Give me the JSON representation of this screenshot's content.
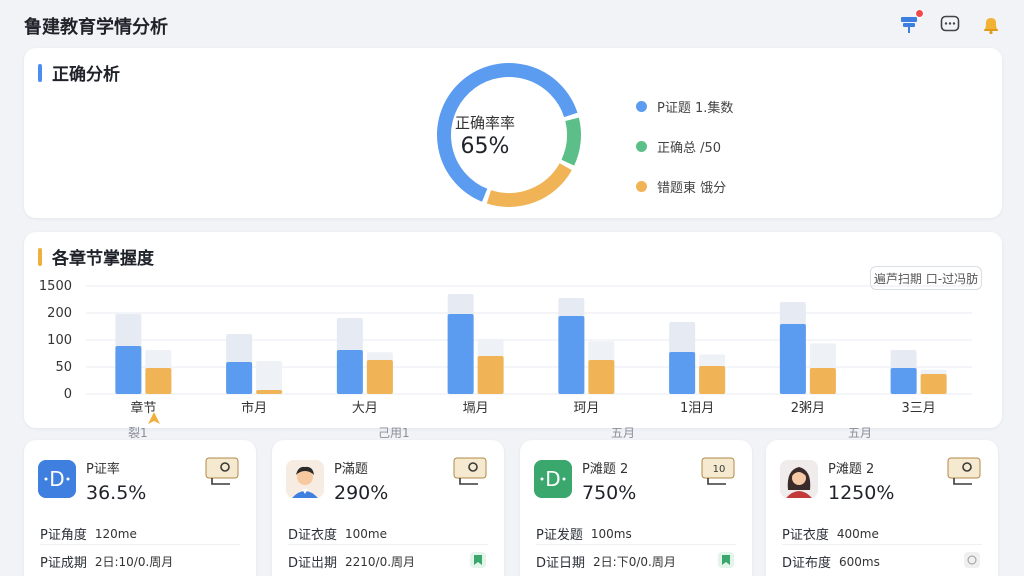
{
  "app_title": "鲁建教育学情分析",
  "accuracy": {
    "title": "正确分析",
    "center_label": "正确率率",
    "center_value": "65%",
    "legend": [
      "P证题 1.集数",
      "正确总 /50",
      "错题東 饿分"
    ],
    "segments": [
      {
        "name": "correct",
        "fraction": 0.65,
        "color": "#5b9cf0"
      },
      {
        "name": "green",
        "fraction": 0.12,
        "color": "#5cbf8a"
      },
      {
        "name": "orange",
        "fraction": 0.23,
        "color": "#f0b456"
      }
    ]
  },
  "chapters": {
    "title": "各章节掌握度",
    "period_button": "遍芦扫期 口-过冯肪",
    "x_sub_labels": [
      "裂1",
      "己用1",
      "五月",
      "五月"
    ]
  },
  "chart_data": {
    "type": "bar",
    "categories": [
      "章节",
      "市月",
      "大月",
      "塥月",
      "珂月",
      "1泪月",
      "2粥月",
      "3三月"
    ],
    "y_tick_labels": [
      "0",
      "50",
      "100",
      "200",
      "1500"
    ],
    "series": [
      {
        "color": "#5b9cf0",
        "values": [
          120,
          80,
          110,
          200,
          195,
          105,
          175,
          65
        ]
      },
      {
        "color": "#f0b456",
        "values": [
          65,
          10,
          85,
          95,
          85,
          70,
          65,
          50
        ]
      }
    ],
    "background_values": [
      200,
      150,
      190,
      250,
      240,
      180,
      230,
      110
    ],
    "ylim": [
      0,
      270
    ],
    "grid": true
  },
  "mini_cards": [
    {
      "name": "P证率",
      "value": "36.5%",
      "row1_label": "P证角度",
      "row1_value": "120me",
      "row2_label": "P证成期",
      "row2_value": "2日:10/0.周月",
      "avatar": "D"
    },
    {
      "name": "P滿题",
      "value": "290%",
      "row1_label": "D证衣度",
      "row1_value": "100me",
      "row2_label": "D证岀期",
      "row2_value": "2210/0.周月",
      "avatar": "boy"
    },
    {
      "name": "P滩题 2",
      "value": "750%",
      "row1_label": "P证发题",
      "row1_value": "100ms",
      "row2_label": "D证日期",
      "row2_value": "2日:下0/0.周月",
      "avatar": "D"
    },
    {
      "name": "P滩题 2",
      "value": "1250%",
      "row1_label": "P证衣度",
      "row1_value": "400me",
      "row2_label": "D证布度",
      "row2_value": "600ms",
      "avatar": "girl"
    }
  ]
}
